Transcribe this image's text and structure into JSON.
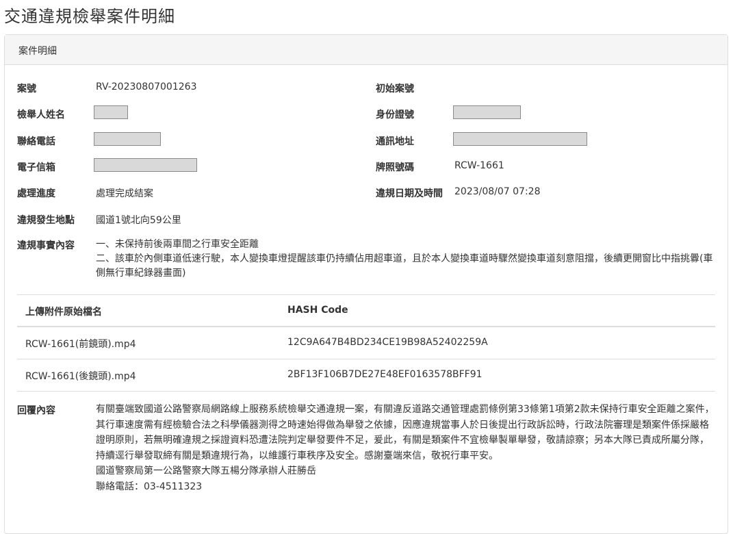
{
  "page": {
    "title": "交通違規檢舉案件明細"
  },
  "panel": {
    "heading": "案件明細"
  },
  "fields": {
    "case_no_label": "案號",
    "case_no_value": "RV-20230807001263",
    "initial_case_label": "初始案號",
    "reporter_name_label": "檢舉人姓名",
    "id_no_label": "身份證號",
    "phone_label": "聯絡電話",
    "address_label": "通訊地址",
    "email_label": "電子信箱",
    "plate_label": "牌照號碼",
    "plate_value": "RCW-1661",
    "progress_label": "處理進度",
    "progress_value": "處理完成結案",
    "datetime_label": "違規日期及時間",
    "datetime_value": "2023/08/07 07:28",
    "location_label": "違規發生地點",
    "location_value": "國道1號北向59公里",
    "facts_label": "違規事實內容",
    "facts_lines": [
      "一、未保持前後兩車間之行車安全距離",
      "二、該車於內側車道低速行駛，本人變換車燈提醒該車仍持續佔用超車道，且於本人變換車道時驟然變換車道刻意阻擋，後續更開窗比中指挑釁(車側無行車紀錄器畫面)"
    ]
  },
  "attachments": {
    "headers": {
      "filename": "上傳附件原始檔名",
      "hash": "HASH Code"
    },
    "rows": [
      {
        "filename": "RCW-1661(前鏡頭).mp4",
        "hash": "12C9A647B4BD234CE19B98A52402259A"
      },
      {
        "filename": "RCW-1661(後鏡頭).mp4",
        "hash": "2BF13F106B7DE27E48EF0163578BFF91"
      }
    ]
  },
  "reply": {
    "label": "回覆內容",
    "body": "有關臺端致國道公路警察局網路線上服務系統檢舉交通違規一案，有關違反道路交通管理處罰條例第33條第1項第2款未保持行車安全距離之案件，其行車速度需有經檢驗合法之科學儀器測得之時速始得做為舉發之依據，因應違規當事人於日後提出行政訴訟時，行政法院審理是類案件係採嚴格證明原則，若無明確違規之採證資料恐遭法院判定舉發要件不足，爰此，有關是類案件不宜檢舉製單舉發，敬請諒察；另本大隊已責成所屬分隊，持續逕行舉發取締有關是類違規行為，以維護行車秩序及安全。感謝臺端來信，敬祝行車平安。",
    "signature": "國道警察局第一公路警察大隊五楊分隊承辦人莊勝岳",
    "contact": "聯絡電話：03-4511323"
  },
  "colors": {
    "redacted_fill": "#d9d9d9",
    "border": "#dddddd",
    "heading_bg": "#f5f5f5"
  }
}
